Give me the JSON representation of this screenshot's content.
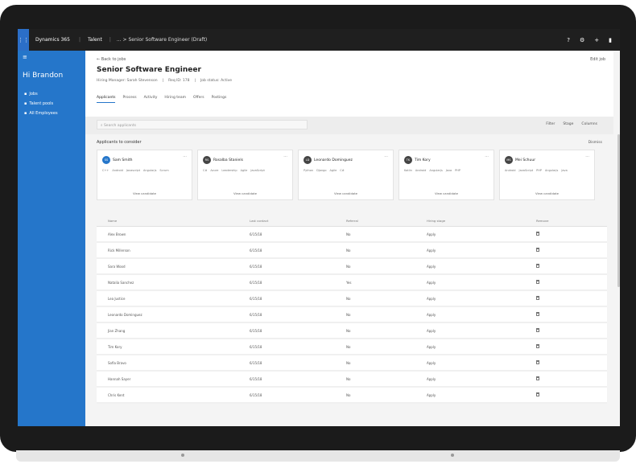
{
  "topbar": {
    "app": "Dynamics 365",
    "area": "Talent",
    "crumb": "... > Senior Software Engineer (Draft)",
    "waffle_icon": "grid-icon",
    "right_icons": [
      "help-icon",
      "settings-icon",
      "plus-icon",
      "user-icon"
    ]
  },
  "sidebar": {
    "menu_icon": "menu-icon",
    "title": "Hi Brandon",
    "items": [
      {
        "icon": "home-icon",
        "label": "Jobs"
      },
      {
        "icon": "list-icon",
        "label": "Talent pools"
      },
      {
        "icon": "people-icon",
        "label": "All Employees"
      }
    ]
  },
  "header": {
    "back": "← Back to jobs",
    "share": "Edit job",
    "title": "Senior Software Engineer",
    "meta": [
      "Hiring Manager: Sarah Stevenson",
      "Req ID: 178",
      "Job status: Active"
    ],
    "tabs": [
      "Applicants",
      "Process",
      "Activity",
      "Hiring team",
      "Offers",
      "Postings"
    ],
    "active_tab": 0
  },
  "toolbar": {
    "search_placeholder": "Search applicants",
    "filters": [
      "Filter",
      "Stage",
      "Columns"
    ]
  },
  "section": {
    "title": "Applicants to consider",
    "link": "Dismiss"
  },
  "cards": [
    {
      "initials": "SS",
      "name": "Sam Smith",
      "tags": [
        "C++",
        "Android",
        "Javascript",
        "Angularjs",
        "Scrum"
      ],
      "foot": "View candidate"
    },
    {
      "initials": "RS",
      "name": "Rosalba Staniels",
      "tags": [
        "C#",
        "Azure",
        "Leadership",
        "Agile",
        "JavaScript"
      ],
      "foot": "View candidate"
    },
    {
      "initials": "LD",
      "name": "Leonardo Dominguez",
      "tags": [
        "Python",
        "Django",
        "Agile",
        "C#"
      ],
      "foot": "View candidate"
    },
    {
      "initials": "TK",
      "name": "Tim Kory",
      "tags": [
        "Kotlin",
        "Android",
        "Angularjs",
        "Java",
        "PHP"
      ],
      "foot": "View candidate"
    },
    {
      "initials": "MS",
      "name": "Mei Schuur",
      "tags": [
        "Android",
        "JavaScript",
        "PHP",
        "Angularjs",
        "Java"
      ],
      "foot": "View candidate"
    }
  ],
  "table": {
    "headers": [
      "Name",
      "Last contact",
      "Referral",
      "Hiring stage",
      "Remove"
    ],
    "rows": [
      [
        "Alex Brown",
        "6/15/18",
        "No",
        "Apply"
      ],
      [
        "Rick Millerson",
        "6/15/18",
        "No",
        "Apply"
      ],
      [
        "Sara Wood",
        "6/15/18",
        "No",
        "Apply"
      ],
      [
        "Natalia Sanchez",
        "6/15/18",
        "Yes",
        "Apply"
      ],
      [
        "Lea Justice",
        "6/15/18",
        "No",
        "Apply"
      ],
      [
        "Leonardo Dominguez",
        "6/15/18",
        "No",
        "Apply"
      ],
      [
        "Jian Zhang",
        "6/15/18",
        "No",
        "Apply"
      ],
      [
        "Tim Kory",
        "6/15/18",
        "No",
        "Apply"
      ],
      [
        "Sofia Bravo",
        "6/15/18",
        "No",
        "Apply"
      ],
      [
        "Hannah Sayer",
        "6/15/18",
        "No",
        "Apply"
      ],
      [
        "Chris Kent",
        "6/15/18",
        "No",
        "Apply"
      ]
    ]
  },
  "colors": {
    "brand": "#2576ca",
    "topbar": "#1f1f1f",
    "content_bg": "#f4f4f4"
  }
}
